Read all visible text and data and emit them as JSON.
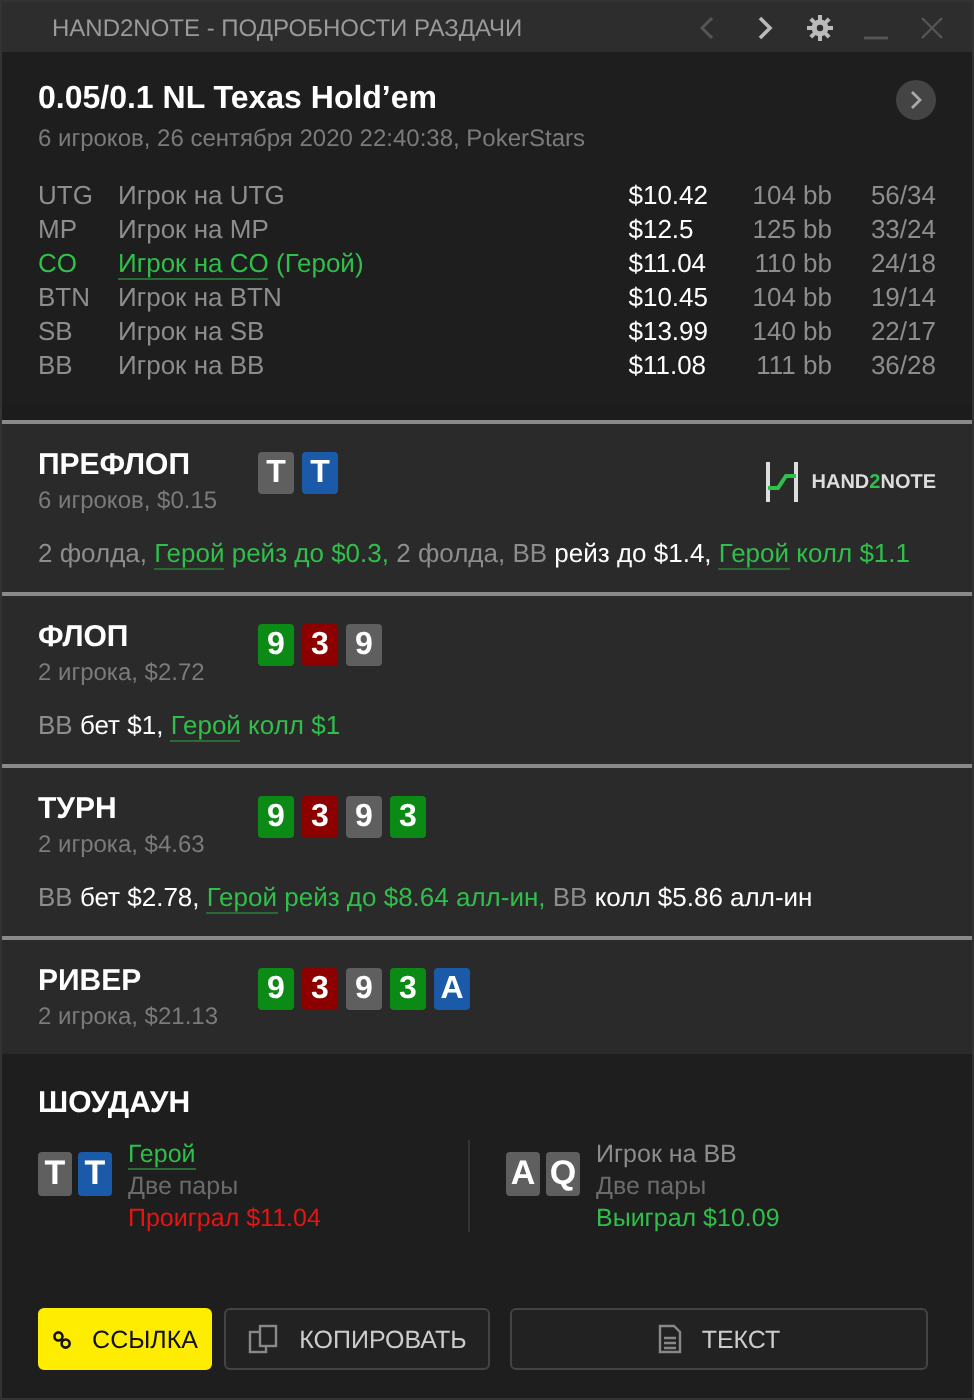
{
  "window": {
    "title": "HAND2NOTE - ПОДРОБНОСТИ РАЗДАЧИ",
    "controls": [
      {
        "kind": "prev",
        "disabled": true
      },
      {
        "kind": "next",
        "disabled": false
      },
      {
        "kind": "settings",
        "disabled": false
      },
      {
        "kind": "minimize",
        "disabled": true
      },
      {
        "kind": "close",
        "disabled": true
      }
    ]
  },
  "hand": {
    "title": "0.05/0.1 NL Texas Hold’em",
    "subtitle": "6 игроков, 26 сентября 2020 22:40:38, PokerStars"
  },
  "players": [
    {
      "position": "UTG",
      "name": "Игрок на UTG",
      "hero": false,
      "stack": "$10.42",
      "bb": "104 bb",
      "stats": "56/34"
    },
    {
      "position": "MP",
      "name": "Игрок на MP",
      "hero": false,
      "stack": "$12.5",
      "bb": "125 bb",
      "stats": "33/24"
    },
    {
      "position": "CO",
      "name": "Игрок на CO",
      "tag": "(Герой)",
      "hero": true,
      "stack": "$11.04",
      "bb": "110 bb",
      "stats": "24/18"
    },
    {
      "position": "BTN",
      "name": "Игрок на BTN",
      "hero": false,
      "stack": "$10.45",
      "bb": "104 bb",
      "stats": "19/14"
    },
    {
      "position": "SB",
      "name": "Игрок на SB",
      "hero": false,
      "stack": "$13.99",
      "bb": "140 bb",
      "stats": "22/17"
    },
    {
      "position": "BB",
      "name": "Игрок на BB",
      "hero": false,
      "stack": "$11.08",
      "bb": "111 bb",
      "stats": "36/28"
    }
  ],
  "streets": [
    {
      "title": "ПРЕФЛОП",
      "subtitle": "6 игроков, $0.15",
      "logo": {
        "text_1": "HAND",
        "text_2": "2",
        "text_3": "NOTE"
      },
      "cards": [
        {
          "rank": "T",
          "color": "#5f5f5f"
        },
        {
          "rank": "T",
          "color": "#1a5aa8"
        }
      ],
      "actions": [
        {
          "kind": "muted",
          "text": "2 фолда, "
        },
        {
          "kind": "hero_name",
          "text": "Герой"
        },
        {
          "kind": "hero",
          "text": " рейз до $0.3,"
        },
        {
          "kind": "muted",
          "text": " 2 фолда, BB"
        },
        {
          "kind": "strong",
          "text": " рейз до $1.4, "
        },
        {
          "kind": "hero_name",
          "text": "Герой"
        },
        {
          "kind": "hero",
          "text": " колл $1.1"
        }
      ]
    },
    {
      "title": "ФЛОП",
      "subtitle": "2 игрока, $2.72",
      "cards": [
        {
          "rank": "9",
          "color": "#0b8a16"
        },
        {
          "rank": "3",
          "color": "#8c0000"
        },
        {
          "rank": "9",
          "color": "#5f5f5f"
        }
      ],
      "actions": [
        {
          "kind": "muted",
          "text": "BB"
        },
        {
          "kind": "strong",
          "text": " бет $1, "
        },
        {
          "kind": "hero_name",
          "text": "Герой"
        },
        {
          "kind": "hero",
          "text": " колл $1"
        }
      ]
    },
    {
      "title": "ТУРН",
      "subtitle": "2 игрока, $4.63",
      "cards": [
        {
          "rank": "9",
          "color": "#0b8a16"
        },
        {
          "rank": "3",
          "color": "#8c0000"
        },
        {
          "rank": "9",
          "color": "#5f5f5f"
        },
        {
          "rank": "3",
          "color": "#0b8a16"
        }
      ],
      "actions": [
        {
          "kind": "muted",
          "text": "BB"
        },
        {
          "kind": "strong",
          "text": " бет $2.78, "
        },
        {
          "kind": "hero_name",
          "text": "Герой"
        },
        {
          "kind": "hero",
          "text": " рейз до $8.64 алл-ин,"
        },
        {
          "kind": "muted",
          "text": " BB"
        },
        {
          "kind": "strong",
          "text": " колл $5.86 алл-ин"
        }
      ]
    },
    {
      "title": "РИВЕР",
      "subtitle": "2 игрока, $21.13",
      "cards": [
        {
          "rank": "9",
          "color": "#0b8a16"
        },
        {
          "rank": "3",
          "color": "#8c0000"
        },
        {
          "rank": "9",
          "color": "#5f5f5f"
        },
        {
          "rank": "3",
          "color": "#0b8a16"
        },
        {
          "rank": "A",
          "color": "#1a5aa8"
        }
      ]
    }
  ],
  "showdown": {
    "title": "ШОУДАУН",
    "players": [
      {
        "name": "Герой",
        "hero": true,
        "hand": "Две пары",
        "result": "Проиграл $11.04",
        "won": false,
        "cards": [
          {
            "rank": "T",
            "color": "#5f5f5f"
          },
          {
            "rank": "T",
            "color": "#1a5aa8"
          }
        ]
      },
      {
        "name": "Игрок на BB",
        "hero": false,
        "hand": "Две пары",
        "result": "Выиграл $10.09",
        "won": true,
        "cards": [
          {
            "rank": "A",
            "color": "#5f5f5f"
          },
          {
            "rank": "Q",
            "color": "#5f5f5f"
          }
        ]
      }
    ]
  },
  "buttons": [
    {
      "kind": "link",
      "label": "ССЫЛКА"
    },
    {
      "kind": "copy",
      "label": "КОПИРОВАТЬ"
    },
    {
      "kind": "text",
      "label": "ТЕКСТ"
    }
  ]
}
